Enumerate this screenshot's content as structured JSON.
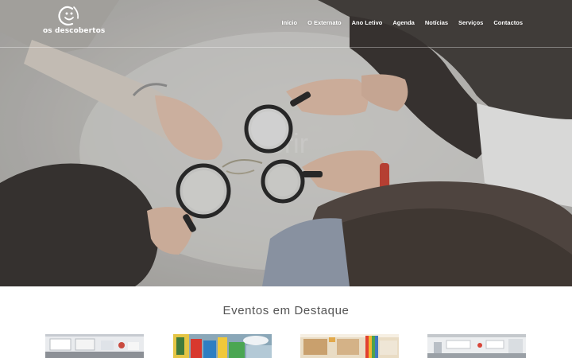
{
  "brand": {
    "name": "os descobertos"
  },
  "nav": {
    "items": [
      {
        "label": "Início"
      },
      {
        "label": "O Externato"
      },
      {
        "label": "Ano Letivo"
      },
      {
        "label": "Agenda"
      },
      {
        "label": "Notícias"
      },
      {
        "label": "Serviços"
      },
      {
        "label": "Contactos"
      }
    ]
  },
  "hero": {
    "watermark_text": "obrir"
  },
  "events": {
    "title": "Eventos em Destaque",
    "cards": [
      {
        "name": "event-card-1"
      },
      {
        "name": "event-card-2"
      },
      {
        "name": "event-card-3"
      },
      {
        "name": "event-card-4"
      }
    ]
  },
  "colors": {
    "hero_overlay": "#b7b6b2",
    "text_white": "#ffffff",
    "title_gray": "#555555",
    "accent_red": "#c0392b"
  }
}
